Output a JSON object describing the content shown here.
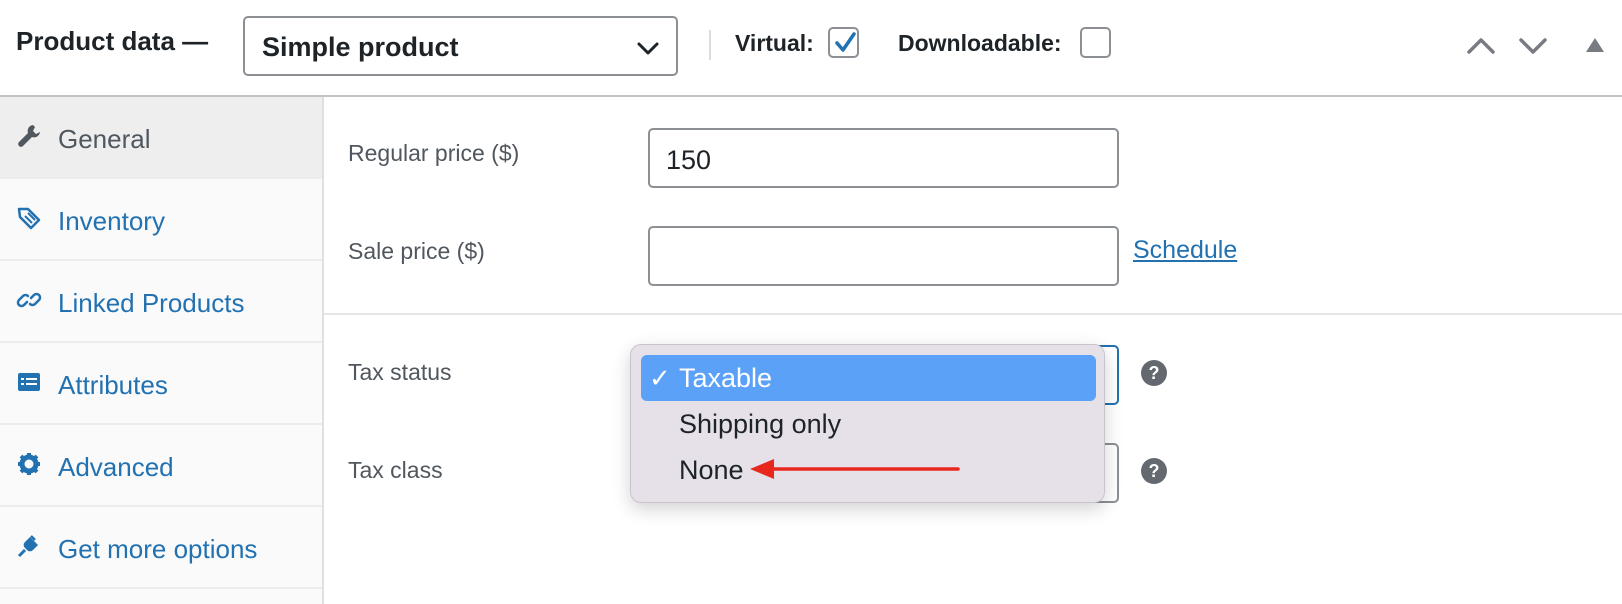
{
  "header": {
    "title": "Product data —",
    "product_type": "Simple product",
    "virtual_label": "Virtual:",
    "virtual_checked": true,
    "downloadable_label": "Downloadable:",
    "downloadable_checked": false,
    "icons": [
      "chevron-up-icon",
      "chevron-down-icon",
      "collapse-triangle-icon"
    ]
  },
  "sidebar": {
    "items": [
      {
        "label": "General",
        "icon": "wrench-icon",
        "active": true
      },
      {
        "label": "Inventory",
        "icon": "tag-icon",
        "active": false
      },
      {
        "label": "Linked Products",
        "icon": "link-icon",
        "active": false
      },
      {
        "label": "Attributes",
        "icon": "list-icon",
        "active": false
      },
      {
        "label": "Advanced",
        "icon": "gear-icon",
        "active": false
      },
      {
        "label": "Get more options",
        "icon": "plug-icon",
        "active": false
      }
    ]
  },
  "pricing": {
    "regular_price_label": "Regular price ($)",
    "regular_price_value": "150",
    "sale_price_label": "Sale price ($)",
    "sale_price_value": "",
    "schedule_link": "Schedule"
  },
  "tax": {
    "status_label": "Tax status",
    "class_label": "Tax class",
    "help_glyph": "?",
    "status_options": [
      {
        "label": "Taxable",
        "selected": true
      },
      {
        "label": "Shipping only",
        "selected": false
      },
      {
        "label": "None",
        "selected": false
      }
    ],
    "check_glyph": "✓"
  },
  "colors": {
    "accent": "#2271b1",
    "selection": "#5aa1f7",
    "annotation_arrow": "#e8281c"
  }
}
